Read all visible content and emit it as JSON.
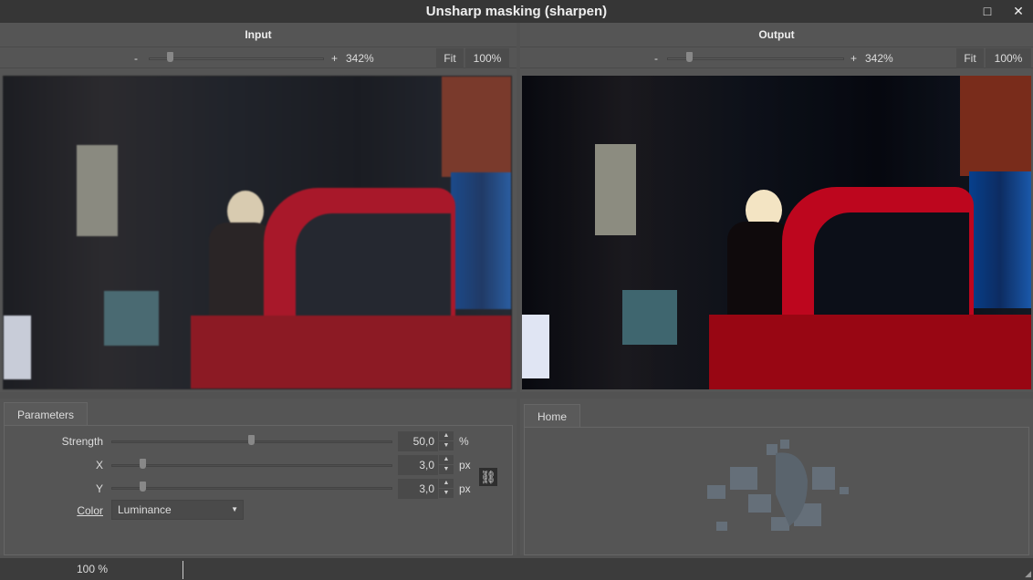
{
  "window": {
    "title": "Unsharp masking (sharpen)",
    "maximize_icon": "□",
    "close_icon": "✕"
  },
  "input_pane": {
    "title": "Input",
    "zoom_minus": "-",
    "zoom_plus": "+",
    "zoom_value": "342%",
    "fit_label": "Fit",
    "actual_label": "100%"
  },
  "output_pane": {
    "title": "Output",
    "zoom_minus": "-",
    "zoom_plus": "+",
    "zoom_value": "342%",
    "fit_label": "Fit",
    "actual_label": "100%"
  },
  "parameters": {
    "tab_label": "Parameters",
    "strength": {
      "label": "Strength",
      "value": "50,0",
      "unit": "%",
      "fraction": 0.5
    },
    "x": {
      "label": "X",
      "value": "3,0",
      "unit": "px",
      "fraction": 0.1
    },
    "y": {
      "label": "Y",
      "value": "3,0",
      "unit": "px",
      "fraction": 0.1
    },
    "color": {
      "label": "Color",
      "value": "Luminance"
    }
  },
  "home": {
    "tab_label": "Home"
  },
  "status": {
    "zoom": "100 %"
  },
  "colors": {
    "accent": "#b5202e"
  }
}
